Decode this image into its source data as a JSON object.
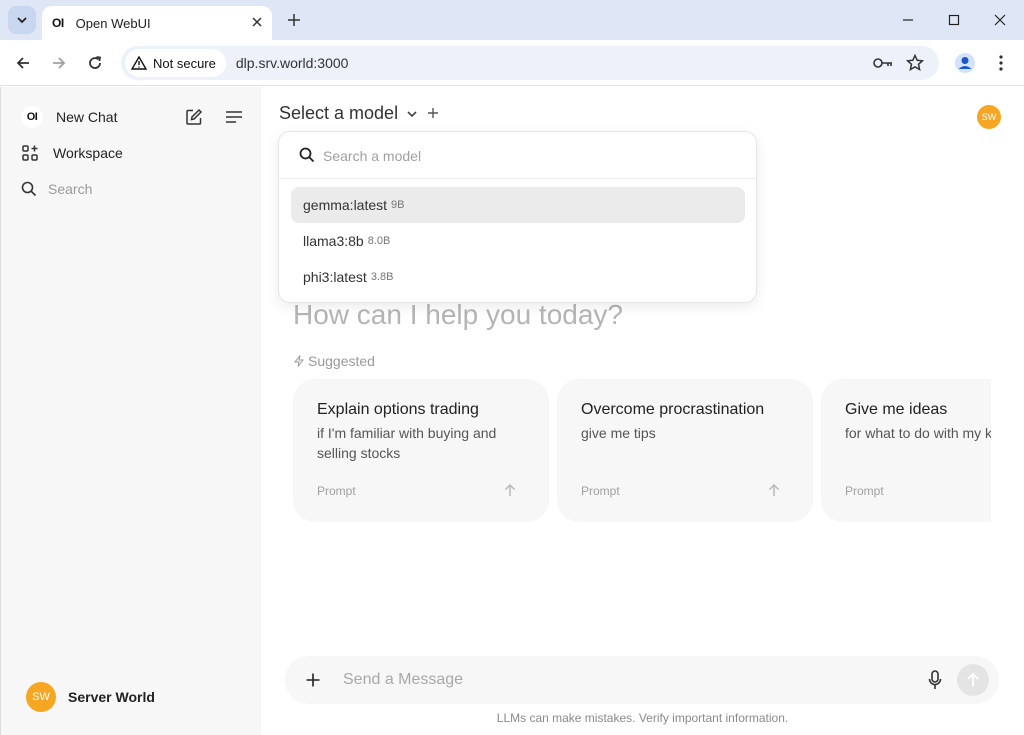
{
  "browser": {
    "tab_title": "Open WebUI",
    "favicon_text": "OI",
    "security_label": "Not secure",
    "url": "dlp.srv.world:3000"
  },
  "sidebar": {
    "logo_text": "OI",
    "new_chat_label": "New Chat",
    "workspace_label": "Workspace",
    "search_label": "Search",
    "user": {
      "initials": "SW",
      "name": "Server World"
    }
  },
  "header": {
    "model_select_label": "Select a model",
    "avatar_initials": "SW"
  },
  "model_dropdown": {
    "search_placeholder": "Search a model",
    "models": [
      {
        "name": "gemma:latest",
        "size": "9B",
        "selected": true
      },
      {
        "name": "llama3:8b",
        "size": "8.0B",
        "selected": false
      },
      {
        "name": "phi3:latest",
        "size": "3.8B",
        "selected": false
      }
    ]
  },
  "main": {
    "greeting": "How can I help you today?",
    "suggested_label": "Suggested",
    "suggestions": [
      {
        "title": "Explain options trading",
        "subtitle": "if I'm familiar with buying and selling stocks",
        "tag": "Prompt"
      },
      {
        "title": "Overcome procrastination",
        "subtitle": "give me tips",
        "tag": "Prompt"
      },
      {
        "title": "Give me ideas",
        "subtitle": "for what to do with my kids' art",
        "tag": "Prompt"
      }
    ]
  },
  "composer": {
    "placeholder": "Send a Message",
    "disclaimer": "LLMs can make mistakes. Verify important information."
  },
  "colors": {
    "avatar": "#f5a623",
    "chrome_titlebar": "#dfe7f7",
    "omnibox": "#edf1f9",
    "sidebar_bg": "#f7f7f7"
  }
}
